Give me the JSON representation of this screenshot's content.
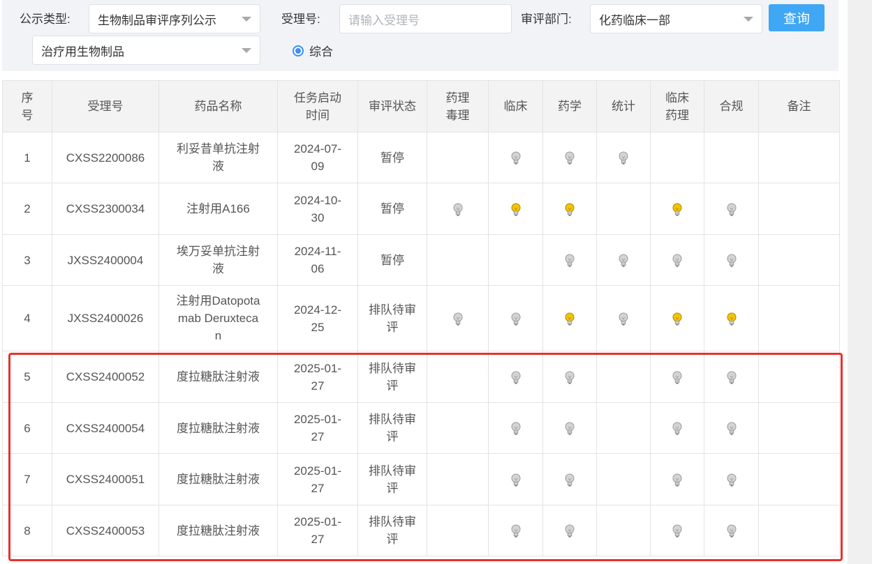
{
  "filters": {
    "type_label": "公示类型:",
    "type_value": "生物制品审评序列公示",
    "subtype_value": "治疗用生物制品",
    "accept_label": "受理号:",
    "accept_placeholder": "请输入受理号",
    "dept_label": "审评部门:",
    "dept_value": "化药临床一部",
    "query_label": "查询",
    "radio_label": "综合"
  },
  "table": {
    "headers": [
      "序号",
      "受理号",
      "药品名称",
      "任务启动时间",
      "审评状态",
      "药理毒理",
      "临床",
      "药学",
      "统计",
      "临床药理",
      "合规",
      "备注"
    ],
    "rows": [
      {
        "no": "1",
        "accept_no": "CXSS2200086",
        "drug": "利妥昔单抗注射液",
        "date": "2024-07-09",
        "status": "暂停",
        "lights": [
          "none",
          "off",
          "off",
          "off",
          "none",
          "none"
        ],
        "note": ""
      },
      {
        "no": "2",
        "accept_no": "CXSS2300034",
        "drug": "注射用A166",
        "date": "2024-10-30",
        "status": "暂停",
        "lights": [
          "off",
          "on",
          "on",
          "none",
          "on",
          "off"
        ],
        "note": ""
      },
      {
        "no": "3",
        "accept_no": "JXSS2400004",
        "drug": "埃万妥单抗注射液",
        "date": "2024-11-06",
        "status": "暂停",
        "lights": [
          "none",
          "none",
          "off",
          "off",
          "off",
          "off"
        ],
        "note": ""
      },
      {
        "no": "4",
        "accept_no": "JXSS2400026",
        "drug": "注射用Datopotamab Deruxtecan",
        "date": "2024-12-25",
        "status": "排队待审评",
        "lights": [
          "off",
          "off",
          "on",
          "off",
          "on",
          "on"
        ],
        "note": ""
      },
      {
        "no": "5",
        "accept_no": "CXSS2400052",
        "drug": "度拉糖肽注射液",
        "date": "2025-01-27",
        "status": "排队待审评",
        "lights": [
          "none",
          "off",
          "off",
          "none",
          "off",
          "off"
        ],
        "note": ""
      },
      {
        "no": "6",
        "accept_no": "CXSS2400054",
        "drug": "度拉糖肽注射液",
        "date": "2025-01-27",
        "status": "排队待审评",
        "lights": [
          "none",
          "off",
          "off",
          "none",
          "off",
          "off"
        ],
        "note": ""
      },
      {
        "no": "7",
        "accept_no": "CXSS2400051",
        "drug": "度拉糖肽注射液",
        "date": "2025-01-27",
        "status": "排队待审评",
        "lights": [
          "none",
          "off",
          "off",
          "none",
          "off",
          "off"
        ],
        "note": ""
      },
      {
        "no": "8",
        "accept_no": "CXSS2400053",
        "drug": "度拉糖肽注射液",
        "date": "2025-01-27",
        "status": "排队待审评",
        "lights": [
          "none",
          "off",
          "off",
          "none",
          "off",
          "off"
        ],
        "note": ""
      }
    ]
  },
  "colors": {
    "bulb_on": "#f5c400",
    "bulb_off": "#d4d4d4",
    "accent": "#3fa7f4",
    "highlight": "#e6322e"
  },
  "icons": {
    "bulb": "lightbulb-icon",
    "caret": "chevron-down-icon",
    "radio": "radio-selected-icon"
  }
}
